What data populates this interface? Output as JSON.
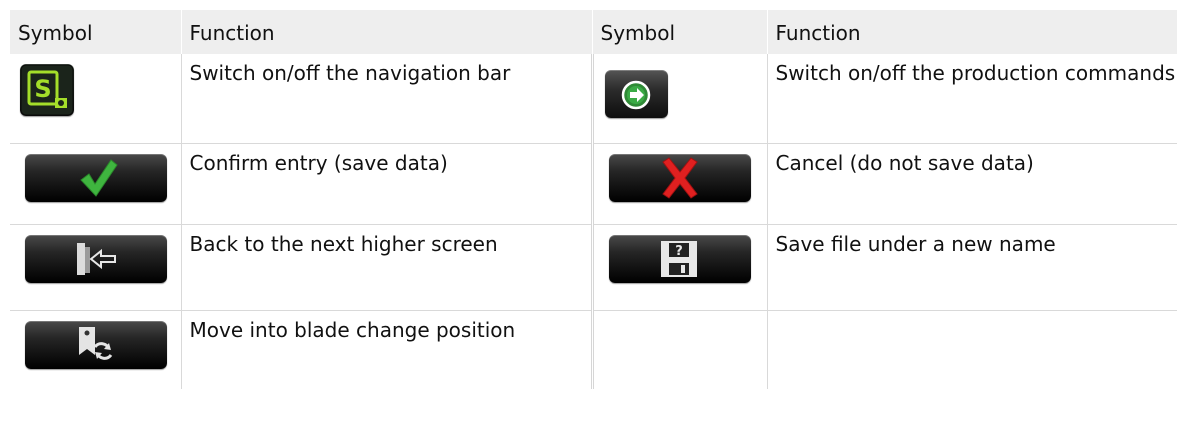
{
  "table": {
    "headers": [
      "Symbol",
      "Function",
      "Symbol",
      "Function"
    ],
    "rows": [
      {
        "left_icon": "navigation-bar-toggle-icon",
        "left_function": "Switch on/off the navigation bar",
        "right_icon": "production-commands-toggle-icon",
        "right_function": "Switch on/off the production commands"
      },
      {
        "left_icon": "confirm-checkmark-icon",
        "left_function": "Confirm entry (save data)",
        "right_icon": "cancel-x-icon",
        "right_function": "Cancel (do not save data)"
      },
      {
        "left_icon": "back-exit-icon",
        "left_function": "Back to the next higher screen",
        "right_icon": "save-as-disk-icon",
        "right_function": "Save file under a new name"
      },
      {
        "left_icon": "blade-change-icon",
        "left_function": "Move into blade change position",
        "right_icon": "",
        "right_function": ""
      }
    ]
  },
  "colors": {
    "header_background": "#eeeeee",
    "grid_line": "#d9d9d9",
    "accent_green": "#8fd11e",
    "check_green": "#3fb53f",
    "cancel_red": "#e02020"
  }
}
